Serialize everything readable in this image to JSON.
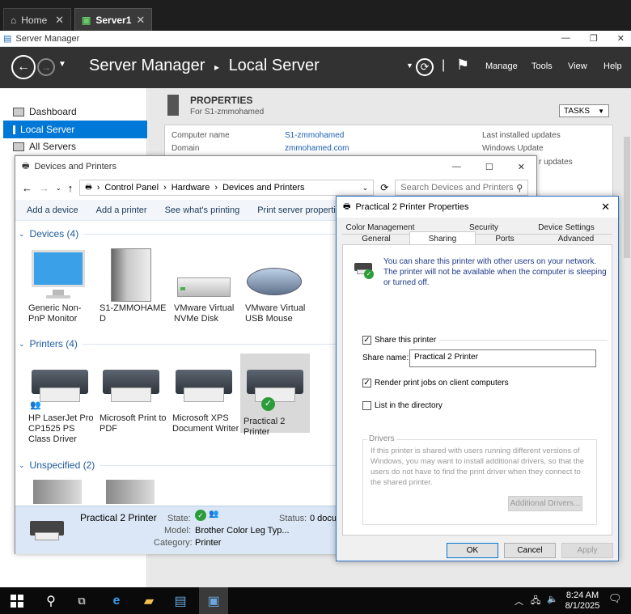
{
  "tabs": {
    "home": "Home",
    "server": "Server1"
  },
  "server_manager": {
    "window_title": "Server Manager",
    "breadcrumb_root": "Server Manager",
    "breadcrumb_current": "Local Server",
    "menu": [
      "Manage",
      "Tools",
      "View",
      "Help"
    ],
    "nav": [
      "Dashboard",
      "Local Server",
      "All Servers"
    ],
    "properties_title": "PROPERTIES",
    "properties_subtitle": "For S1-zmmohamed",
    "tasks_label": "TASKS",
    "props": {
      "computer_name_label": "Computer name",
      "computer_name_value": "S1-zmmohamed",
      "domain_label": "Domain",
      "domain_value": "zmmohamed.com",
      "last_updates_label": "Last installed updates",
      "windows_update_label": "Windows Update",
      "partial_text": "r updates"
    }
  },
  "devices_printers": {
    "window_title": "Devices and Printers",
    "address": {
      "root": "Control Panel",
      "mid": "Hardware",
      "current": "Devices and Printers"
    },
    "search_placeholder": "Search Devices and Printers",
    "commands": [
      "Add a device",
      "Add a printer",
      "See what's printing",
      "Print server properties"
    ],
    "groups": {
      "devices": "Devices (4)",
      "printers": "Printers (4)",
      "unspecified": "Unspecified (2)"
    },
    "devices": [
      {
        "name": "Generic Non-PnP Monitor",
        "icon": "monitor-icon"
      },
      {
        "name": "S1-ZMMOHAMED",
        "icon": "tower-icon"
      },
      {
        "name": "VMware Virtual NVMe Disk",
        "icon": "disk-icon"
      },
      {
        "name": "VMware Virtual USB Mouse",
        "icon": "mouse-icon"
      }
    ],
    "printers": [
      {
        "name": "HP LaserJet Pro CP1525 PS Class Driver",
        "icon": "printer-icon"
      },
      {
        "name": "Microsoft Print to PDF",
        "icon": "printer-icon"
      },
      {
        "name": "Microsoft XPS Document Writer",
        "icon": "printer-icon"
      },
      {
        "name": "Practical 2 Printer",
        "icon": "printer-icon",
        "selected": true
      }
    ],
    "details": {
      "name": "Practical 2 Printer",
      "state_label": "State:",
      "status_label": "Status:",
      "status_value": "0 docu",
      "model_label": "Model:",
      "model_value": "Brother Color Leg Typ...",
      "category_label": "Category:",
      "category_value": "Printer"
    }
  },
  "printer_props": {
    "window_title": "Practical 2 Printer Properties",
    "tabs_row1": [
      "Color Management",
      "Security",
      "Device Settings"
    ],
    "tabs_row2": [
      "General",
      "Sharing",
      "Ports",
      "Advanced"
    ],
    "active_tab": "Sharing",
    "info_text": "You can share this printer with other users on your network. The printer will not be available when the computer is sleeping or turned off.",
    "share_checkbox": "Share this printer",
    "share_name_label": "Share name:",
    "share_name_value": "Practical 2 Printer",
    "render_checkbox": "Render print jobs on client computers",
    "list_checkbox": "List in the directory",
    "drivers_title": "Drivers",
    "drivers_text": "If this printer is shared with users running different versions of Windows, you may want to install additional drivers, so that the users do not have to find the print driver when they connect to the shared printer.",
    "additional_drivers_button": "Additional Drivers...",
    "ok": "OK",
    "cancel": "Cancel",
    "apply": "Apply"
  },
  "taskbar": {
    "time": "8:24 AM",
    "date": "8/1/2025"
  },
  "colors": {
    "accent": "#0078d7",
    "header": "#323232",
    "link": "#1e5aa0"
  }
}
